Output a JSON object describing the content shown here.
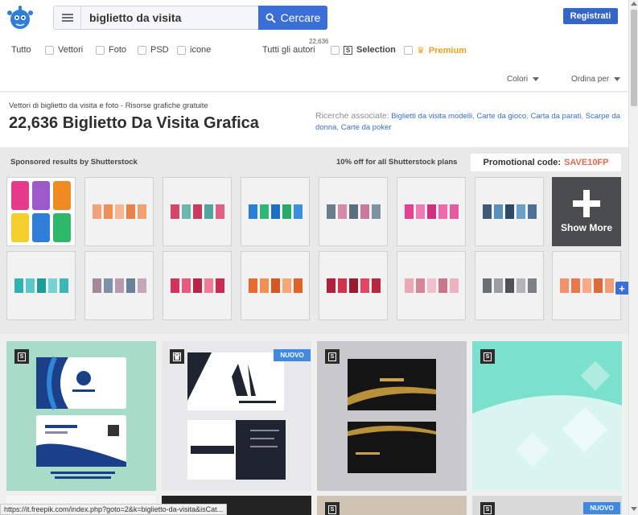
{
  "search": {
    "value": "biglietto da visita",
    "button_label": "Cercare"
  },
  "header": {
    "register_label": "Registrati"
  },
  "filters": {
    "all": "Tutto",
    "vectors": "Vettori",
    "photos": "Foto",
    "psd": "PSD",
    "icons": "icone",
    "all_authors": "Tutti gli autori",
    "count": "22,636",
    "selection": "Selection",
    "premium": "Premium",
    "colors": "Colori",
    "sort": "Ordina per"
  },
  "title": {
    "subtitle": "Vettori di biglietto da visita e foto - Risorse grafiche gratuite",
    "main": "22,636 Biglietto Da Visita Grafica"
  },
  "related": {
    "label": "Ricerche associate:",
    "links": [
      "Biglietti da visita modelli",
      "Carte da gioco",
      "Carta da parati",
      "Scarpe da donna",
      "Carte da poker"
    ]
  },
  "sponsored": {
    "label": "Sponsored results by Shutterstock",
    "offer": "10% off for all Shutterstock plans",
    "promo_label": "Promotional code:",
    "promo_code": "SAVE10FP",
    "show_more": "Show More"
  },
  "results": {
    "new_badge": "NUOVO"
  },
  "status_bar": {
    "url": "https://it.freepik.com/index.php?goto=2&k=biglietto-da-visita&isCat..."
  },
  "colors": {
    "accent": "#3a6fd8",
    "register": "#3566c7",
    "premium": "#f0a020",
    "promo": "#e26a4e"
  }
}
